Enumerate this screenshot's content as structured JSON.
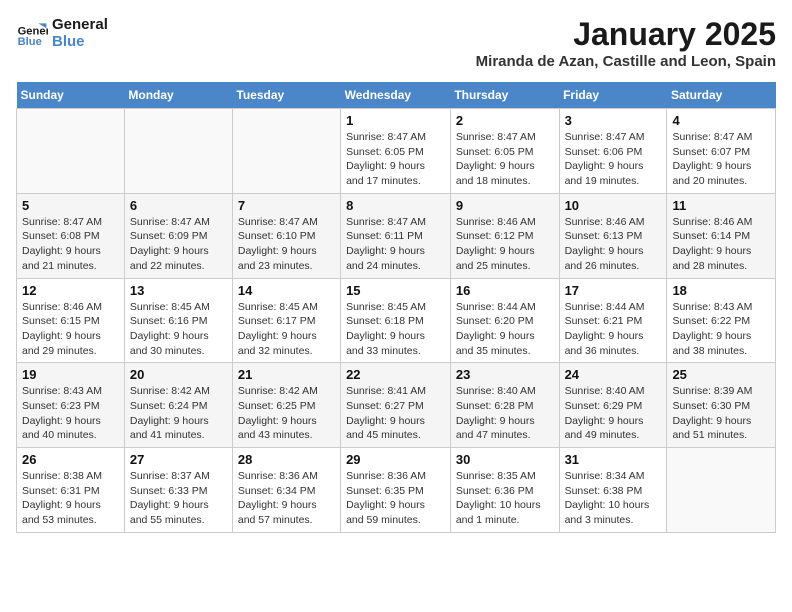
{
  "logo": {
    "line1": "General",
    "line2": "Blue"
  },
  "title": "January 2025",
  "subtitle": "Miranda de Azan, Castille and Leon, Spain",
  "days_of_week": [
    "Sunday",
    "Monday",
    "Tuesday",
    "Wednesday",
    "Thursday",
    "Friday",
    "Saturday"
  ],
  "weeks": [
    [
      {
        "day": "",
        "info": ""
      },
      {
        "day": "",
        "info": ""
      },
      {
        "day": "",
        "info": ""
      },
      {
        "day": "1",
        "info": "Sunrise: 8:47 AM\nSunset: 6:05 PM\nDaylight: 9 hours and 17 minutes."
      },
      {
        "day": "2",
        "info": "Sunrise: 8:47 AM\nSunset: 6:05 PM\nDaylight: 9 hours and 18 minutes."
      },
      {
        "day": "3",
        "info": "Sunrise: 8:47 AM\nSunset: 6:06 PM\nDaylight: 9 hours and 19 minutes."
      },
      {
        "day": "4",
        "info": "Sunrise: 8:47 AM\nSunset: 6:07 PM\nDaylight: 9 hours and 20 minutes."
      }
    ],
    [
      {
        "day": "5",
        "info": "Sunrise: 8:47 AM\nSunset: 6:08 PM\nDaylight: 9 hours and 21 minutes."
      },
      {
        "day": "6",
        "info": "Sunrise: 8:47 AM\nSunset: 6:09 PM\nDaylight: 9 hours and 22 minutes."
      },
      {
        "day": "7",
        "info": "Sunrise: 8:47 AM\nSunset: 6:10 PM\nDaylight: 9 hours and 23 minutes."
      },
      {
        "day": "8",
        "info": "Sunrise: 8:47 AM\nSunset: 6:11 PM\nDaylight: 9 hours and 24 minutes."
      },
      {
        "day": "9",
        "info": "Sunrise: 8:46 AM\nSunset: 6:12 PM\nDaylight: 9 hours and 25 minutes."
      },
      {
        "day": "10",
        "info": "Sunrise: 8:46 AM\nSunset: 6:13 PM\nDaylight: 9 hours and 26 minutes."
      },
      {
        "day": "11",
        "info": "Sunrise: 8:46 AM\nSunset: 6:14 PM\nDaylight: 9 hours and 28 minutes."
      }
    ],
    [
      {
        "day": "12",
        "info": "Sunrise: 8:46 AM\nSunset: 6:15 PM\nDaylight: 9 hours and 29 minutes."
      },
      {
        "day": "13",
        "info": "Sunrise: 8:45 AM\nSunset: 6:16 PM\nDaylight: 9 hours and 30 minutes."
      },
      {
        "day": "14",
        "info": "Sunrise: 8:45 AM\nSunset: 6:17 PM\nDaylight: 9 hours and 32 minutes."
      },
      {
        "day": "15",
        "info": "Sunrise: 8:45 AM\nSunset: 6:18 PM\nDaylight: 9 hours and 33 minutes."
      },
      {
        "day": "16",
        "info": "Sunrise: 8:44 AM\nSunset: 6:20 PM\nDaylight: 9 hours and 35 minutes."
      },
      {
        "day": "17",
        "info": "Sunrise: 8:44 AM\nSunset: 6:21 PM\nDaylight: 9 hours and 36 minutes."
      },
      {
        "day": "18",
        "info": "Sunrise: 8:43 AM\nSunset: 6:22 PM\nDaylight: 9 hours and 38 minutes."
      }
    ],
    [
      {
        "day": "19",
        "info": "Sunrise: 8:43 AM\nSunset: 6:23 PM\nDaylight: 9 hours and 40 minutes."
      },
      {
        "day": "20",
        "info": "Sunrise: 8:42 AM\nSunset: 6:24 PM\nDaylight: 9 hours and 41 minutes."
      },
      {
        "day": "21",
        "info": "Sunrise: 8:42 AM\nSunset: 6:25 PM\nDaylight: 9 hours and 43 minutes."
      },
      {
        "day": "22",
        "info": "Sunrise: 8:41 AM\nSunset: 6:27 PM\nDaylight: 9 hours and 45 minutes."
      },
      {
        "day": "23",
        "info": "Sunrise: 8:40 AM\nSunset: 6:28 PM\nDaylight: 9 hours and 47 minutes."
      },
      {
        "day": "24",
        "info": "Sunrise: 8:40 AM\nSunset: 6:29 PM\nDaylight: 9 hours and 49 minutes."
      },
      {
        "day": "25",
        "info": "Sunrise: 8:39 AM\nSunset: 6:30 PM\nDaylight: 9 hours and 51 minutes."
      }
    ],
    [
      {
        "day": "26",
        "info": "Sunrise: 8:38 AM\nSunset: 6:31 PM\nDaylight: 9 hours and 53 minutes."
      },
      {
        "day": "27",
        "info": "Sunrise: 8:37 AM\nSunset: 6:33 PM\nDaylight: 9 hours and 55 minutes."
      },
      {
        "day": "28",
        "info": "Sunrise: 8:36 AM\nSunset: 6:34 PM\nDaylight: 9 hours and 57 minutes."
      },
      {
        "day": "29",
        "info": "Sunrise: 8:36 AM\nSunset: 6:35 PM\nDaylight: 9 hours and 59 minutes."
      },
      {
        "day": "30",
        "info": "Sunrise: 8:35 AM\nSunset: 6:36 PM\nDaylight: 10 hours and 1 minute."
      },
      {
        "day": "31",
        "info": "Sunrise: 8:34 AM\nSunset: 6:38 PM\nDaylight: 10 hours and 3 minutes."
      },
      {
        "day": "",
        "info": ""
      }
    ]
  ]
}
